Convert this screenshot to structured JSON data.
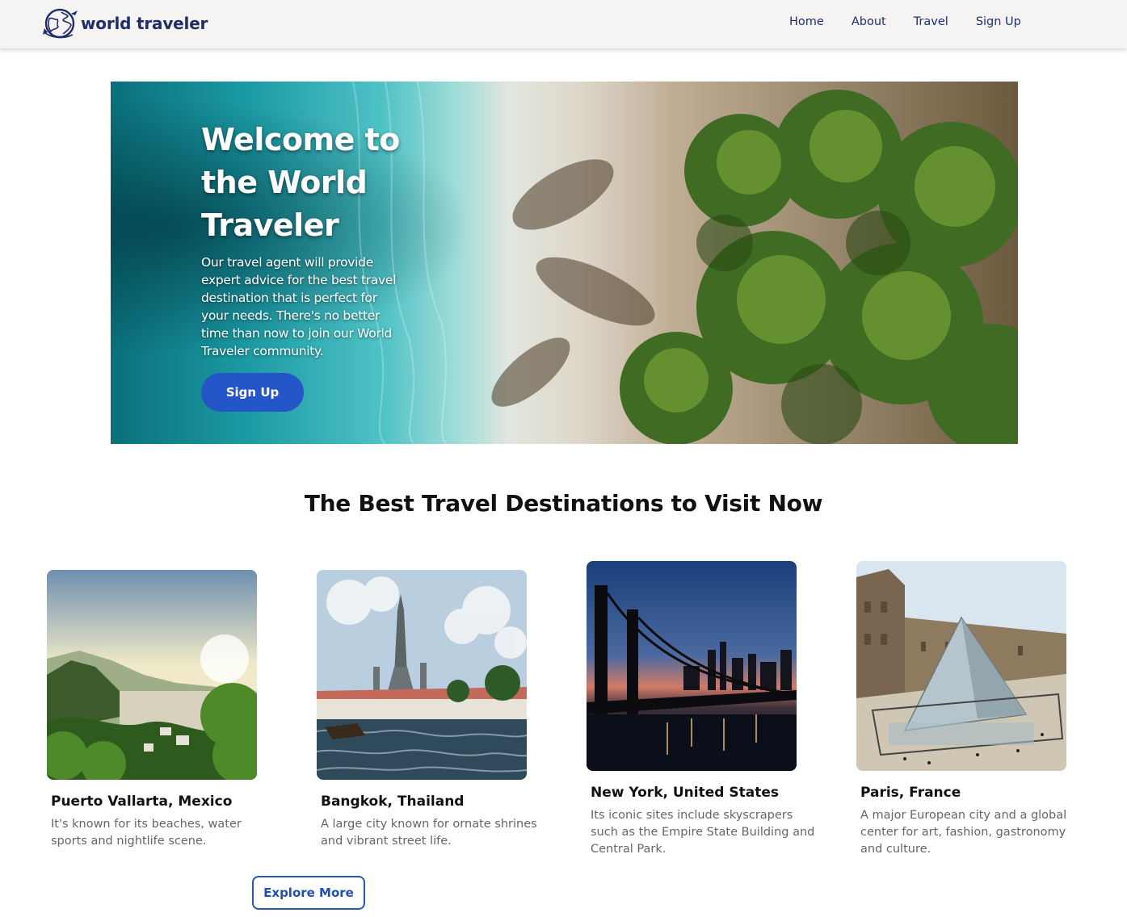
{
  "brand": {
    "name": "world traveler",
    "logo_icon": "globe-plane-icon",
    "color": "#1d2e6b"
  },
  "nav": {
    "items": [
      {
        "label": "Home"
      },
      {
        "label": "About"
      },
      {
        "label": "Travel"
      },
      {
        "label": "Sign Up"
      }
    ]
  },
  "hero": {
    "title": "Welcome to the World Traveler",
    "description": "Our travel agent will provide expert advice for the best travel destination that is perfect for your needs. There's no better time than now to join our World Traveler community.",
    "button_label": "Sign Up",
    "button_color": "#2456c9"
  },
  "section": {
    "title": "The Best Travel Destinations to Visit Now"
  },
  "destinations": [
    {
      "title": "Puerto Vallarta, Mexico",
      "description": "It's known for its beaches, water sports and nightlife scene."
    },
    {
      "title": "Bangkok, Thailand",
      "description": "A large city known for ornate shrines and vibrant street life."
    },
    {
      "title": "New York, United States",
      "description": "Its iconic sites include skyscrapers such as the Empire State Building and Central Park."
    },
    {
      "title": "Paris, France",
      "description": "A major European city and a global center for art, fashion, gastronomy and culture."
    }
  ],
  "explore": {
    "button_label": "Explore More",
    "color": "#2b56b8"
  }
}
